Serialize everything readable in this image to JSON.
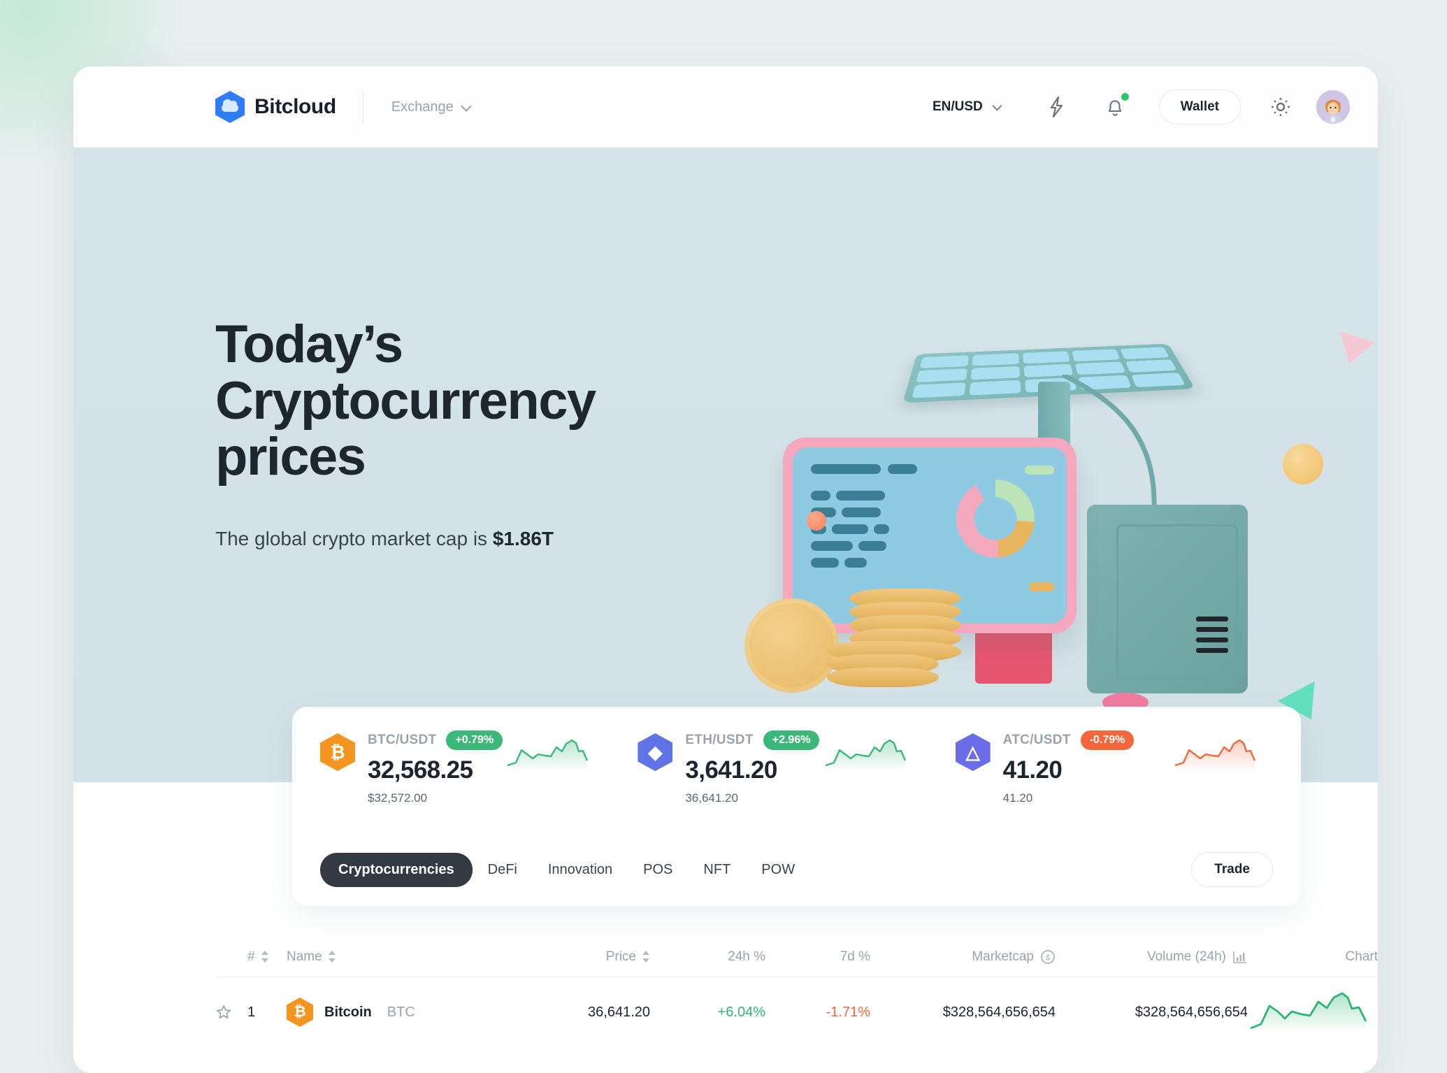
{
  "brand": {
    "name": "Bitcloud",
    "logo_icon": "bitcloud-hexagon-cloud-icon",
    "accent": "#2f7cf6"
  },
  "header": {
    "nav": {
      "exchange_label": "Exchange",
      "chevron_icon": "chevron-down-icon"
    },
    "language": {
      "value": "EN/USD",
      "chevron_icon": "chevron-down-icon"
    },
    "flash_icon": "lightning-bolt-icon",
    "notifications": {
      "icon": "bell-icon",
      "has_unread": true,
      "badge_color": "#2fc46b"
    },
    "wallet_label": "Wallet",
    "theme_icon": "sun-brightness-icon",
    "avatar_icon": "user-avatar"
  },
  "hero": {
    "title_line1": "Today’s",
    "title_line2": "Cryptocurrency",
    "title_line3": "prices",
    "subtitle_prefix": "The global crypto market cap is ",
    "market_cap": "$1.86T",
    "background": "#d4e2e8",
    "illustration": "3d-solar-panel-dashboard-coins-server"
  },
  "tickers": [
    {
      "icon": "bitcoin-icon",
      "pair": "BTC/USDT",
      "change": "+0.79%",
      "direction": "up",
      "price": "32,568.25",
      "alt_price": "$32,572.00",
      "spark_color": "#3cb878"
    },
    {
      "icon": "ethereum-icon",
      "pair": "ETH/USDT",
      "change": "+2.96%",
      "direction": "up",
      "price": "3,641.20",
      "alt_price": "36,641.20",
      "spark_color": "#3cb878"
    },
    {
      "icon": "atc-icon",
      "pair": "ATC/USDT",
      "change": "-0.79%",
      "direction": "down",
      "price": "41.20",
      "alt_price": "41.20",
      "spark_color": "#f4673b"
    }
  ],
  "tabs": [
    {
      "label": "Cryptocurrencies",
      "active": true
    },
    {
      "label": "DeFi",
      "active": false
    },
    {
      "label": "Innovation",
      "active": false
    },
    {
      "label": "POS",
      "active": false
    },
    {
      "label": "NFT",
      "active": false
    },
    {
      "label": "POW",
      "active": false
    }
  ],
  "trade_button": "Trade",
  "table": {
    "columns": {
      "rank": "#",
      "name": "Name",
      "price": "Price",
      "change_24h": "24h %",
      "change_7d": "7d %",
      "marketcap": "Marketcap",
      "marketcap_icon": "dollar-circle-icon",
      "volume": "Volume (24h)",
      "volume_icon": "bar-chart-icon",
      "chart": "Chart"
    },
    "rows": [
      {
        "favorite_icon": "star-outline-icon",
        "rank": "1",
        "coin_icon": "bitcoin-icon",
        "name": "Bitcoin",
        "symbol": "BTC",
        "price": "36,641.20",
        "change_24h": "+6.04%",
        "change_24h_dir": "up",
        "change_7d": "-1.71%",
        "change_7d_dir": "down",
        "marketcap": "$328,564,656,654",
        "volume": "$328,564,656,654",
        "chart_color": "#2fb473"
      }
    ]
  },
  "colors": {
    "up": "#2fb473",
    "down": "#f4673b",
    "text_dark": "#1c242e",
    "text_muted": "#9aa3ab",
    "page_bg": "#e8eff0"
  }
}
